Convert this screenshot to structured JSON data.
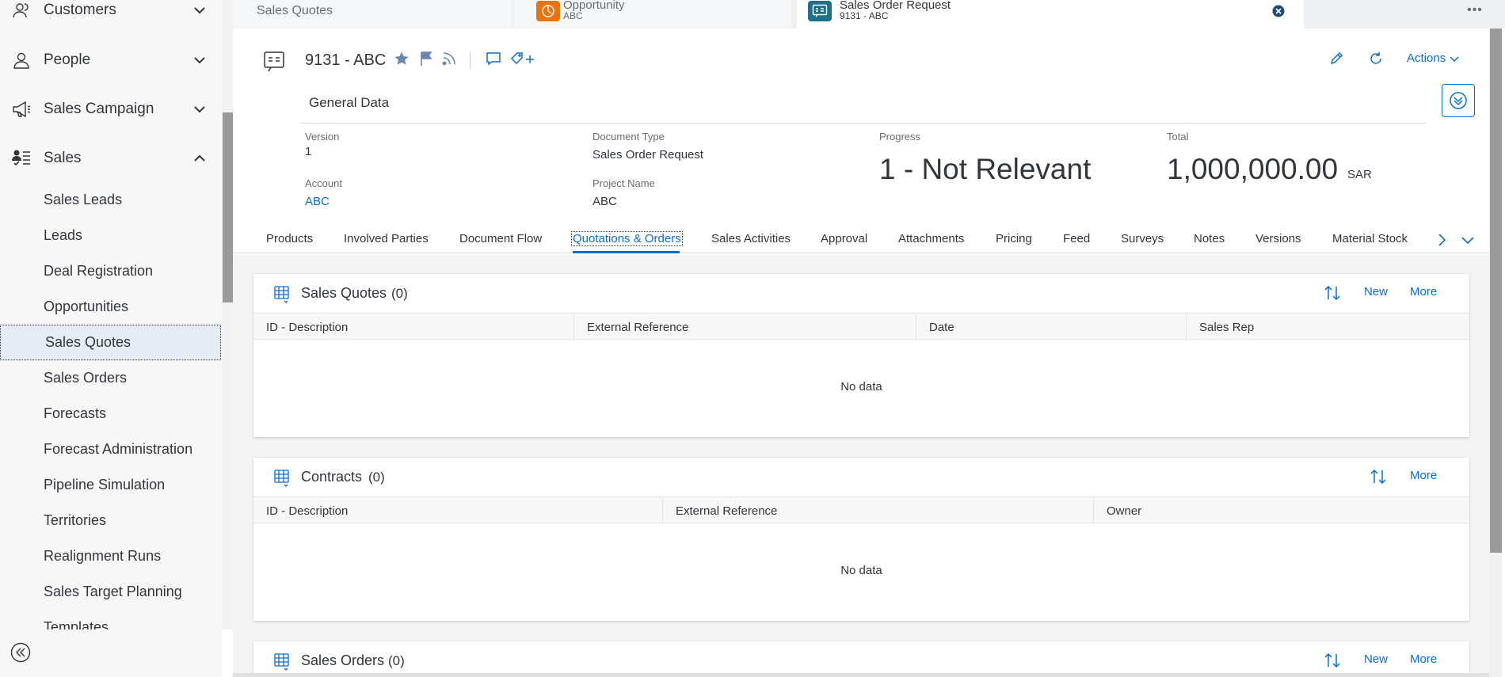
{
  "sidebar": {
    "groups": [
      {
        "label": "Customers",
        "icon": "customers-icon",
        "expanded": false
      },
      {
        "label": "People",
        "icon": "person-icon",
        "expanded": false
      },
      {
        "label": "Sales Campaign",
        "icon": "megaphone-icon",
        "expanded": false
      },
      {
        "label": "Sales",
        "icon": "sales-icon",
        "expanded": true
      }
    ],
    "sales_items": [
      "Sales Leads",
      "Leads",
      "Deal Registration",
      "Opportunities",
      "Sales Quotes",
      "Sales Orders",
      "Forecasts",
      "Forecast Administration",
      "Pipeline Simulation",
      "Territories",
      "Realignment Runs",
      "Sales Target Planning",
      "Templates"
    ],
    "selected_item": "Sales Quotes"
  },
  "tabs": [
    {
      "title": "Sales Quotes",
      "subtitle": "",
      "active": false
    },
    {
      "title": "Opportunity",
      "subtitle": "ABC",
      "active": false,
      "icon_color": "#e9730c"
    },
    {
      "title": "Sales Order Request",
      "subtitle": "9131 - ABC",
      "active": true,
      "icon_color": "#1d6f8a"
    }
  ],
  "tab_overflow": "•••",
  "header": {
    "title": "9131 - ABC",
    "actions_label": "Actions"
  },
  "general": {
    "section_title": "General Data",
    "version_label": "Version",
    "version_value": "1",
    "doc_type_label": "Document Type",
    "doc_type_value": "Sales Order Request",
    "progress_label": "Progress",
    "progress_value": "1 - Not Relevant",
    "total_label": "Total",
    "total_value": "1,000,000.00",
    "total_currency": "SAR",
    "account_label": "Account",
    "account_value": "ABC",
    "project_label": "Project Name",
    "project_value": "ABC"
  },
  "section_tabs": [
    "Products",
    "Involved Parties",
    "Document Flow",
    "Quotations & Orders",
    "Sales Activities",
    "Approval",
    "Attachments",
    "Pricing",
    "Feed",
    "Surveys",
    "Notes",
    "Versions",
    "Material Stock"
  ],
  "active_section_tab": "Quotations & Orders",
  "panels": {
    "sales_quotes": {
      "title": "Sales Quotes",
      "count": "(0)",
      "new_label": "New",
      "more_label": "More",
      "columns": [
        "ID - Description",
        "External Reference",
        "Date",
        "Sales Rep"
      ],
      "empty_text": "No data"
    },
    "contracts": {
      "title": "Contracts",
      "count": "(0)",
      "more_label": "More",
      "columns": [
        "ID - Description",
        "External Reference",
        "Owner"
      ],
      "empty_text": "No data"
    },
    "sales_orders": {
      "title": "Sales Orders",
      "count": "(0)",
      "new_label": "New",
      "more_label": "More"
    }
  },
  "colors": {
    "accent": "#0a6ed1",
    "selected_bg": "#e5ecf6",
    "opportunity_icon": "#e9730c",
    "order_icon": "#1d6f8a"
  }
}
